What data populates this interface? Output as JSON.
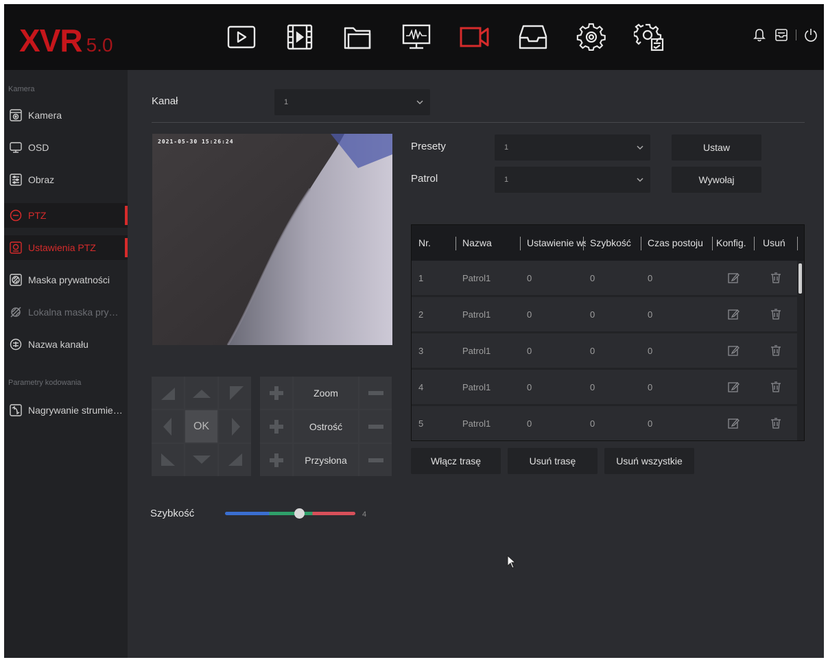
{
  "app": {
    "logo_main": "XVR",
    "logo_version": "5.0"
  },
  "topbar": {
    "nav": [
      {
        "name": "playback-icon"
      },
      {
        "name": "video-clip-icon"
      },
      {
        "name": "files-icon"
      },
      {
        "name": "monitor-icon"
      },
      {
        "name": "camera-icon",
        "active": true
      },
      {
        "name": "storage-icon"
      },
      {
        "name": "settings-icon"
      },
      {
        "name": "system-settings-icon"
      }
    ],
    "right_icons": [
      "bell-icon",
      "tray-icon",
      "power-icon"
    ]
  },
  "sidebar": {
    "section1": "Kamera",
    "items1": [
      {
        "label": "Kamera",
        "icon": "camera-dome-icon"
      },
      {
        "label": "OSD",
        "icon": "monitor-icon"
      },
      {
        "label": "Obraz",
        "icon": "image-settings-icon"
      },
      {
        "label": "PTZ",
        "icon": "ptz-icon",
        "active": true
      },
      {
        "label": "Ustawienia PTZ",
        "icon": "ptz-settings-icon",
        "active": true
      },
      {
        "label": "Maska prywatności",
        "icon": "privacy-mask-icon"
      },
      {
        "label": "Lokalna maska prywat...",
        "icon": "local-mask-icon",
        "disabled": true
      },
      {
        "label": "Nazwa kanału",
        "icon": "channel-name-icon"
      }
    ],
    "section2": "Parametry kodowania",
    "items2": [
      {
        "label": "Nagrywanie strumienia",
        "icon": "stream-icon"
      }
    ]
  },
  "main": {
    "channel_label": "Kanał",
    "channel_value": "1",
    "video_timestamp": "2021-05-30 15:26:24",
    "presets_label": "Presety",
    "presets_value": "1",
    "patrol_label": "Patrol",
    "patrol_value": "1",
    "set_button": "Ustaw",
    "call_button": "Wywołaj",
    "ok_label": "OK",
    "zoom_label": "Zoom",
    "focus_label": "Ostrość",
    "iris_label": "Przysłona",
    "speed_label": "Szybkość",
    "speed_value": "4",
    "speed_fraction": 0.57,
    "enable_route_button": "Włącz trasę",
    "delete_route_button": "Usuń trasę",
    "delete_all_button": "Usuń wszystkie"
  },
  "table": {
    "headers": [
      "Nr.",
      "Nazwa",
      "Ustawienie wst",
      "Szybkość",
      "Czas postoju",
      "Konfig.",
      "Usuń"
    ],
    "rows": [
      {
        "nr": "1",
        "name": "Patrol1",
        "preset": "0",
        "speed": "0",
        "dwell": "0"
      },
      {
        "nr": "2",
        "name": "Patrol1",
        "preset": "0",
        "speed": "0",
        "dwell": "0"
      },
      {
        "nr": "3",
        "name": "Patrol1",
        "preset": "0",
        "speed": "0",
        "dwell": "0"
      },
      {
        "nr": "4",
        "name": "Patrol1",
        "preset": "0",
        "speed": "0",
        "dwell": "0"
      },
      {
        "nr": "5",
        "name": "Patrol1",
        "preset": "0",
        "speed": "0",
        "dwell": "0"
      }
    ]
  },
  "colors": {
    "accent": "#d62b2b",
    "background": "#2b2c30",
    "topbar": "#0f0f10",
    "sidebar": "#212225"
  }
}
